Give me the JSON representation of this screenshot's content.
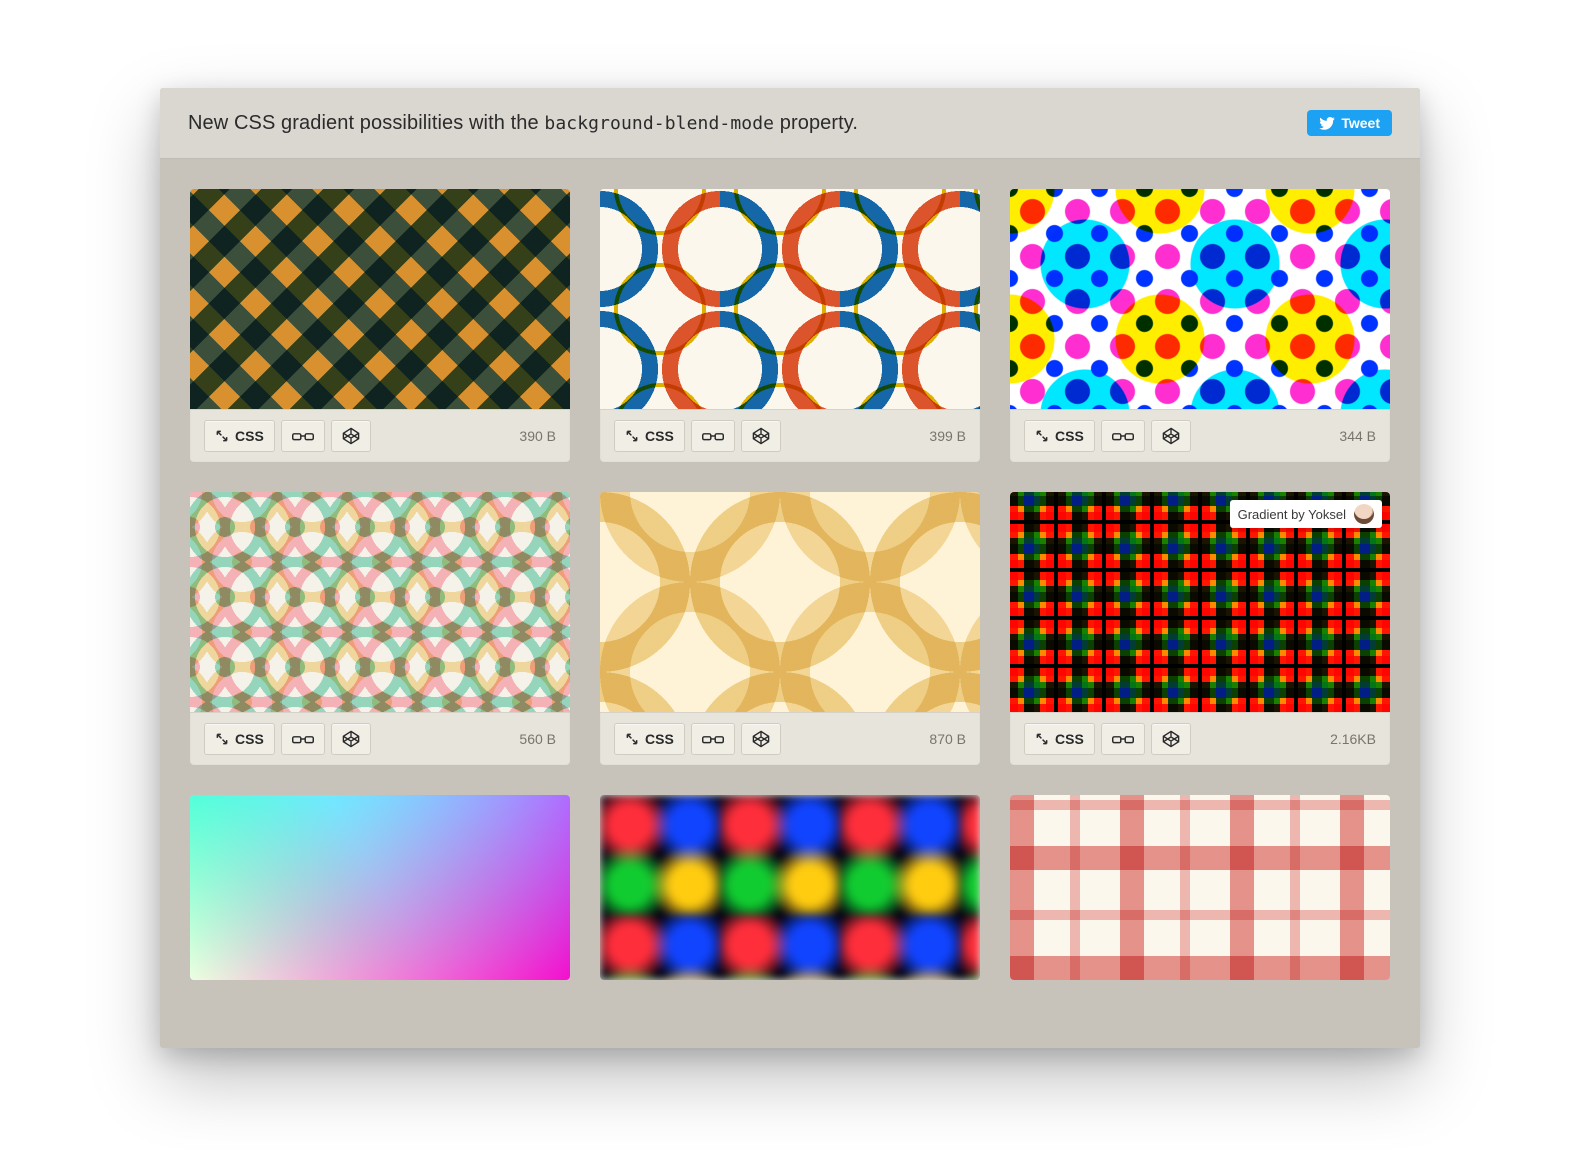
{
  "header": {
    "title_prefix": "New CSS gradient possibilities with the ",
    "title_code": "background-blend-mode",
    "title_suffix": " property.",
    "tweet_label": "Tweet"
  },
  "buttons": {
    "css": "CSS"
  },
  "cards": [
    {
      "size": "390 B"
    },
    {
      "size": "399 B"
    },
    {
      "size": "344 B"
    },
    {
      "size": "560 B"
    },
    {
      "size": "870 B"
    },
    {
      "size": "2.16KB",
      "credit": "Gradient by Yoksel"
    },
    {
      "size": ""
    },
    {
      "size": ""
    },
    {
      "size": ""
    }
  ]
}
